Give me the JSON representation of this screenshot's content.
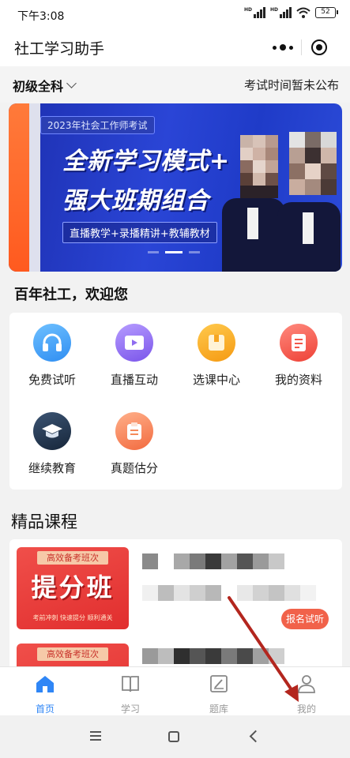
{
  "status_bar": {
    "time": "下午3:08",
    "signal1": "HD",
    "signal2": "HD",
    "battery": "52"
  },
  "header": {
    "title": "社工学习助手",
    "more_icon": "more-dots-icon",
    "close_icon": "target-circle-icon"
  },
  "level_row": {
    "selected": "初级全科",
    "exam_time": "考试时间暂未公布"
  },
  "banner": {
    "tag": "2023年社会工作师考试",
    "line1": "全新学习模式+",
    "line2": "强大班期组合",
    "subtitle": "直播教学+录播精讲+教辅教材",
    "active_slide": 2,
    "slide_count": 3
  },
  "welcome": "百年社工，欢迎您",
  "quick_actions": [
    {
      "label": "免费试听",
      "icon": "headphones-icon",
      "color": "#3aa0f5"
    },
    {
      "label": "直播互动",
      "icon": "video-play-icon",
      "color": "#8f6cf0"
    },
    {
      "label": "选课中心",
      "icon": "box-icon",
      "color": "#f9a21e"
    },
    {
      "label": "我的资料",
      "icon": "document-icon",
      "color": "#f2574a"
    },
    {
      "label": "继续教育",
      "icon": "graduation-cap-icon",
      "color": "#23344a"
    },
    {
      "label": "真题估分",
      "icon": "clipboard-icon",
      "color": "#f58a5a"
    }
  ],
  "courses_section": {
    "title": "精品课程"
  },
  "courses": [
    {
      "thumb_top": "高效备考班次",
      "thumb_main": "提分班",
      "thumb_sub": "考前冲刺 快速提分 顺利通关",
      "button": "报名试听"
    },
    {
      "thumb_top": "高效备考班次"
    }
  ],
  "tabbar": [
    {
      "label": "首页",
      "icon": "home-icon",
      "active": true
    },
    {
      "label": "学习",
      "icon": "book-icon",
      "active": false
    },
    {
      "label": "题库",
      "icon": "edit-icon",
      "active": false
    },
    {
      "label": "我的",
      "icon": "user-icon",
      "active": false
    }
  ],
  "system_nav": {
    "menu_icon": "menu-icon",
    "home_icon": "square-icon",
    "back_icon": "back-icon"
  },
  "colors": {
    "accent_blue": "#2f86f6",
    "course_red": "#e53a35",
    "banner_blue": "#2a45d6"
  }
}
